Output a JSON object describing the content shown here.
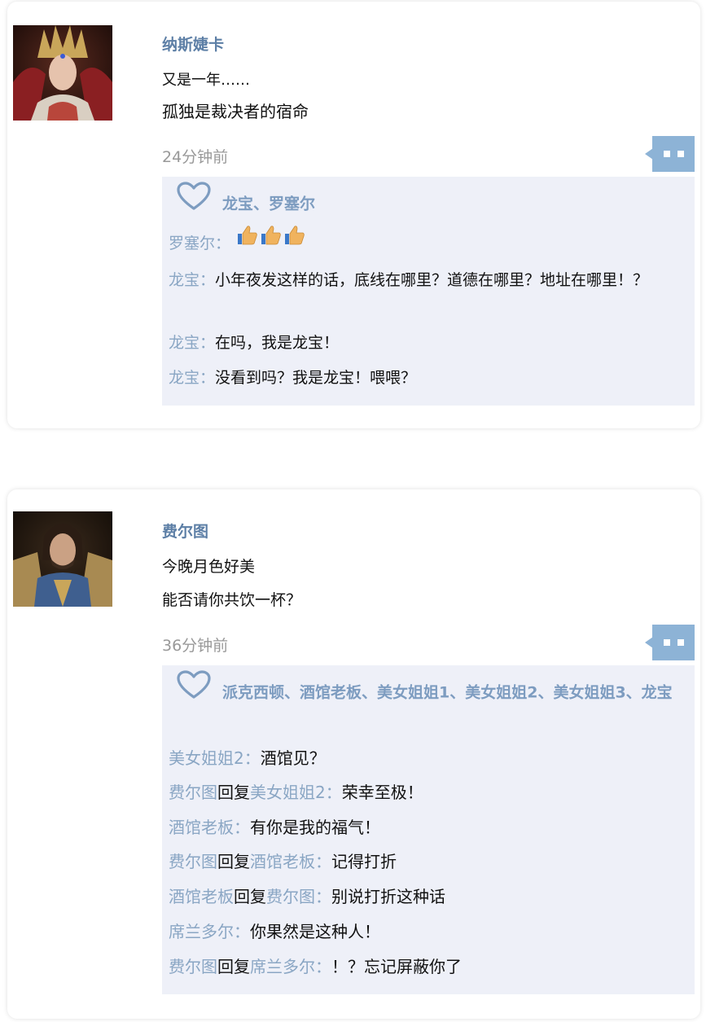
{
  "posts": [
    {
      "author": "纳斯婕卡",
      "lines": [
        "又是一年……",
        "孤独是裁决者的宿命"
      ],
      "time": "24分钟前",
      "likes": "龙宝、罗塞尔",
      "comments": [
        {
          "from": "罗塞尔",
          "sep": "：",
          "text": "",
          "emoji": "thumbs-up x3"
        },
        {
          "from": "龙宝",
          "sep": "：",
          "text": "小年夜发这样的话，底线在哪里？道德在哪里？地址在哪里！？"
        },
        {
          "from": "龙宝",
          "sep": "：",
          "text": "在吗，我是龙宝！"
        },
        {
          "from": "龙宝",
          "sep": "：",
          "text": "没看到吗？我是龙宝！喂喂？"
        }
      ]
    },
    {
      "author": "费尔图",
      "lines": [
        "今晚月色好美",
        "能否请你共饮一杯？"
      ],
      "time": "36分钟前",
      "likes": "派克西顿、酒馆老板、美女姐姐1、美女姐姐2、美女姐姐3、龙宝",
      "comments": [
        {
          "from": "美女姐姐2",
          "sep": "：",
          "text": "酒馆见？"
        },
        {
          "from": "费尔图",
          "reply": "回复",
          "to": "美女姐姐2",
          "sep": "：",
          "text": "荣幸至极！"
        },
        {
          "from": "酒馆老板",
          "sep": "：",
          "text": "有你是我的福气！"
        },
        {
          "from": "费尔图",
          "reply": "回复",
          "to": "酒馆老板",
          "sep": "：",
          "text": "记得打折"
        },
        {
          "from": "酒馆老板",
          "reply": "回复",
          "to": "费尔图",
          "sep": "：",
          "text": "别说打折这种话"
        },
        {
          "from": "席兰多尔",
          "sep": "：",
          "text": "你果然是这种人！"
        },
        {
          "from": "费尔图",
          "reply": "回复",
          "to": "席兰多尔",
          "sep": "：",
          "text": "！？忘记屏蔽你了"
        }
      ]
    }
  ],
  "icons": {
    "like": "heart-outline-icon",
    "comment": "comment-bubble-icon",
    "emoji": "thumbs-up-emoji"
  },
  "colors": {
    "name": "#5d7fa6",
    "commenter": "#8aa6c4",
    "panel_bg": "#eef0f8",
    "time": "#999999",
    "comment_button": "#8db3d6"
  }
}
